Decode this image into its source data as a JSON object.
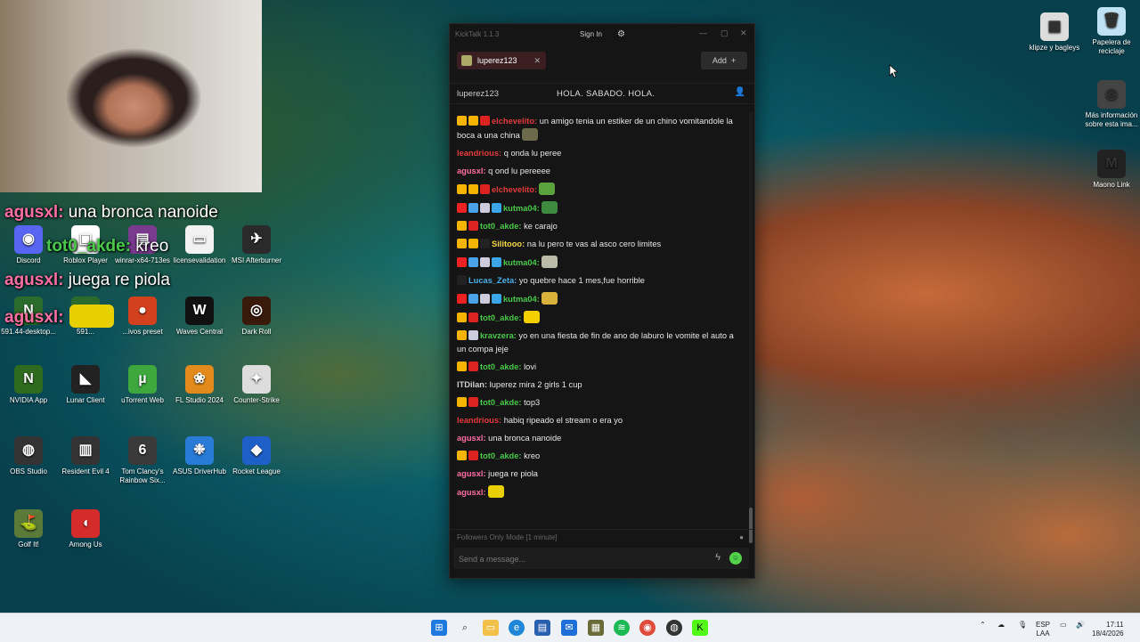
{
  "webcam_overlay": [
    {
      "user": "agusxl",
      "text": " una bronca nanoide"
    },
    {
      "user": "tot0_akde",
      "text": " kreo"
    },
    {
      "user": "agusxl",
      "text": " juega re piola"
    },
    {
      "user": "agusxl",
      "text": ""
    }
  ],
  "desktop_icons_left": [
    {
      "label": "Discord",
      "color": "#5865f2",
      "glyph": "◉"
    },
    {
      "label": "Roblox Player",
      "color": "#ffffff",
      "glyph": "▣"
    },
    {
      "label": "winrar-x64-713es",
      "color": "#7a3b8f",
      "glyph": "▤"
    },
    {
      "label": "licensevalidation",
      "color": "#f2f2f2",
      "glyph": "▭"
    },
    {
      "label": "MSI Afterburner",
      "color": "#2a2a2a",
      "glyph": "✈"
    },
    {
      "label": "591.44-desktop...",
      "color": "#2b6b2b",
      "glyph": "N"
    },
    {
      "label": "591...",
      "color": "#2b6b2b",
      "glyph": "N"
    },
    {
      "label": "...ivos preset",
      "color": "#d2401e",
      "glyph": "●"
    },
    {
      "label": "Waves Central",
      "color": "#111111",
      "glyph": "W"
    },
    {
      "label": "Dark Roll",
      "color": "#3a1a0a",
      "glyph": "◎"
    },
    {
      "label": "NVIDIA App",
      "color": "#2f6b1f",
      "glyph": "N"
    },
    {
      "label": "Lunar Client",
      "color": "#222222",
      "glyph": "◣"
    },
    {
      "label": "uTorrent Web",
      "color": "#3ea83e",
      "glyph": "µ"
    },
    {
      "label": "FL Studio 2024",
      "color": "#e28a1c",
      "glyph": "❀"
    },
    {
      "label": "Counter-Strike",
      "color": "#dddddd",
      "glyph": "✦"
    },
    {
      "label": "OBS Studio",
      "color": "#333333",
      "glyph": "◍"
    },
    {
      "label": "Resident Evil 4",
      "color": "#333333",
      "glyph": "▥"
    },
    {
      "label": "Tom Clancy's Rainbow Six...",
      "color": "#3a3a3a",
      "glyph": "6"
    },
    {
      "label": "ASUS DriverHub",
      "color": "#2a7ad8",
      "glyph": "❉"
    },
    {
      "label": "Rocket League",
      "color": "#1e5fc8",
      "glyph": "◆"
    },
    {
      "label": "Golf It!",
      "color": "#5a7a3a",
      "glyph": "⛳"
    },
    {
      "label": "Among Us",
      "color": "#d42b2b",
      "glyph": "◖"
    }
  ],
  "desktop_icons_right": [
    {
      "label": "klipze y bagleys",
      "color": "#ddd",
      "glyph": "▦"
    },
    {
      "label": "Papelera de reciclaje",
      "color": "#bfe3f5",
      "glyph": "🗑"
    },
    {
      "label": "Más información sobre esta ima...",
      "color": "#444",
      "glyph": "◎"
    },
    {
      "label": "Maono Link",
      "color": "#222",
      "glyph": "M"
    }
  ],
  "kicktalk": {
    "title": "KickTalk 1.1.3",
    "sign_in": "Sign In",
    "tab_label": "luperez123",
    "add_label": "Add",
    "channel": "luperez123",
    "pinned": "HOLA. SABADO. HOLA.",
    "followers_mode": "Followers Only Mode [1 minute]",
    "input_placeholder": "Send a message...",
    "messages": [
      {
        "badges": [
          "#f5b400",
          "#f5b400",
          "#d22"
        ],
        "nick": "elchevelito:",
        "color": "#e33b3b",
        "text": " un amigo tenia un estiker de un chino vomitandole la boca a una china",
        "emote": "#6b6a4a"
      },
      {
        "badges": [],
        "nick": "leandrious:",
        "color": "#e33b3b",
        "text": " q onda lu peree",
        "emote": ""
      },
      {
        "badges": [],
        "nick": "agusxl:",
        "color": "#ff6fa3",
        "text": " q ond lu pereeee",
        "emote": ""
      },
      {
        "badges": [
          "#f5b400",
          "#f5b400",
          "#d22"
        ],
        "nick": "elchevelito:",
        "color": "#e33b3b",
        "text": "",
        "emote": "#5aa23c"
      },
      {
        "badges": [
          "#e22",
          "#4aa3e8",
          "#ccd",
          "#3aa6e8"
        ],
        "nick": "kutma04:",
        "color": "#4ac94a",
        "text": "",
        "emote": "#3e8a3e"
      },
      {
        "badges": [
          "#f5b400",
          "#d22"
        ],
        "nick": "tot0_akde:",
        "color": "#4ac94a",
        "text": " ke carajo",
        "emote": ""
      },
      {
        "badges": [
          "#f5b400",
          "#f5b400",
          "#222"
        ],
        "nick": "Silitooo:",
        "color": "#f5d94a",
        "text": " na lu pero te vas al asco cero limites",
        "emote": ""
      },
      {
        "badges": [
          "#e22",
          "#4aa3e8",
          "#ccd",
          "#3aa6e8"
        ],
        "nick": "kutma04:",
        "color": "#4ac94a",
        "text": "",
        "emote": "#bba"
      },
      {
        "badges": [
          "#222"
        ],
        "nick": "Lucas_Zeta:",
        "color": "#4ab0e8",
        "text": " yo quebre hace 1 mes,fue horrible",
        "emote": ""
      },
      {
        "badges": [
          "#e22",
          "#4aa3e8",
          "#ccd",
          "#3aa6e8"
        ],
        "nick": "kutma04:",
        "color": "#4ac94a",
        "text": "",
        "emote": "#d8b23a"
      },
      {
        "badges": [
          "#f5b400",
          "#d22"
        ],
        "nick": "tot0_akde:",
        "color": "#4ac94a",
        "text": "",
        "emote": "#f5d000"
      },
      {
        "badges": [
          "#f5b400",
          "#ccd"
        ],
        "nick": "kravzera:",
        "color": "#4ac94a",
        "text": " yo en una fiesta de fin de ano de laburo le vomite el auto a un compa jeje",
        "emote": ""
      },
      {
        "badges": [
          "#f5b400",
          "#d22"
        ],
        "nick": "tot0_akde:",
        "color": "#4ac94a",
        "text": " lovi",
        "emote": ""
      },
      {
        "badges": [],
        "nick": "ITDilan:",
        "color": "#cfcfcf",
        "text": " luperez mira 2 girls 1 cup",
        "emote": ""
      },
      {
        "badges": [
          "#f5b400",
          "#d22"
        ],
        "nick": "tot0_akde:",
        "color": "#4ac94a",
        "text": " top3",
        "emote": ""
      },
      {
        "badges": [],
        "nick": "leandrious:",
        "color": "#e33b3b",
        "text": " habiq ripeado el stream o era yo",
        "emote": ""
      },
      {
        "badges": [],
        "nick": "agusxl:",
        "color": "#ff6fa3",
        "text": " una bronca nanoide",
        "emote": ""
      },
      {
        "badges": [
          "#f5b400",
          "#d22"
        ],
        "nick": "tot0_akde:",
        "color": "#4ac94a",
        "text": " kreo",
        "emote": ""
      },
      {
        "badges": [],
        "nick": "agusxl:",
        "color": "#ff6fa3",
        "text": " juega re piola",
        "emote": ""
      },
      {
        "badges": [],
        "nick": "agusxl:",
        "color": "#ff6fa3",
        "text": "",
        "emote": "#e8d000"
      }
    ]
  },
  "tray": {
    "lang": "ESP",
    "layout": "LAA",
    "time": "17:11",
    "date": "18/4/2026"
  }
}
